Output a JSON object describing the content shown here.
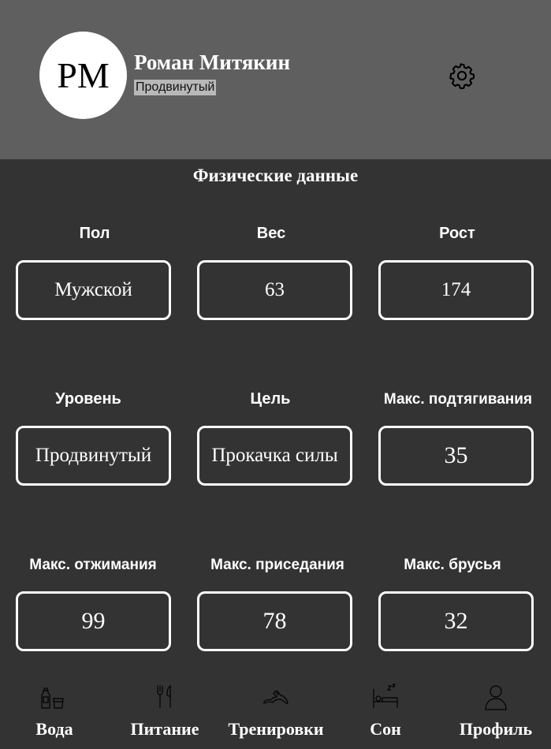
{
  "profile": {
    "initials": "PM",
    "name": "Роман Митякин",
    "level": "Продвинутый"
  },
  "section_title": "Физические данные",
  "fields": [
    {
      "label": "Пол",
      "value": "Мужской"
    },
    {
      "label": "Вес",
      "value": "63"
    },
    {
      "label": "Рост",
      "value": "174"
    },
    {
      "label": "Уровень",
      "value": "Продвинутый"
    },
    {
      "label": "Цель",
      "value": "Прокачка силы"
    },
    {
      "label": "Макс. подтягивания",
      "value": "35"
    },
    {
      "label": "Макс. отжимания",
      "value": "99"
    },
    {
      "label": "Макс. приседания",
      "value": "78"
    },
    {
      "label": "Макс. брусья",
      "value": "32"
    }
  ],
  "nav": [
    {
      "label": "Вода",
      "icon": "water-icon"
    },
    {
      "label": "Питание",
      "icon": "cutlery-icon"
    },
    {
      "label": "Тренировки",
      "icon": "muscle-arm-icon"
    },
    {
      "label": "Сон",
      "icon": "bed-icon"
    },
    {
      "label": "Профиль",
      "icon": "user-icon"
    }
  ]
}
